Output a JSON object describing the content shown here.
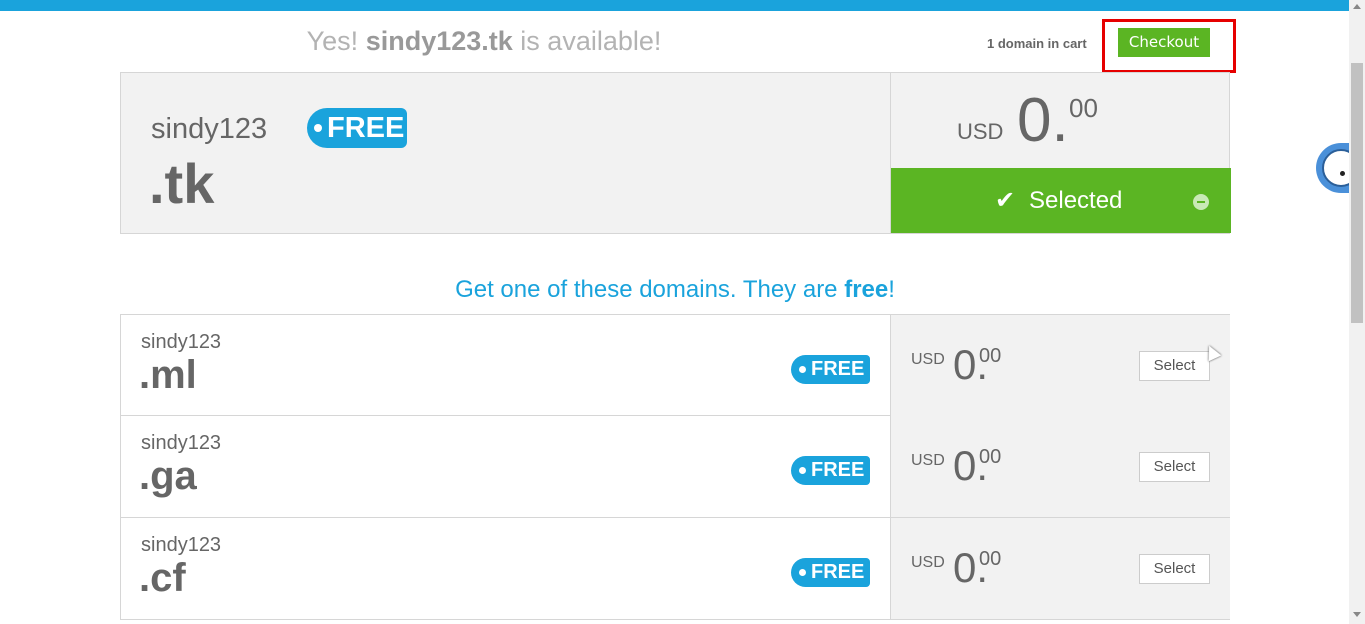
{
  "header": {
    "availability_prefix": "Yes!",
    "availability_domain": "sindy123.tk",
    "availability_suffix": "is available!",
    "cart_count_text": "1 domain in cart",
    "checkout_label": "Checkout"
  },
  "selected_domain": {
    "name": "sindy123",
    "tld": ".tk",
    "badge": "FREE",
    "currency": "USD",
    "price_int": "0.",
    "price_dec": "00",
    "selected_label": "Selected"
  },
  "suggestions": {
    "heading_prefix": "Get one of these domains. They are",
    "heading_bold": "free",
    "heading_suffix": "!",
    "items": [
      {
        "name": "sindy123",
        "tld": ".ml",
        "badge": "FREE",
        "currency": "USD",
        "price_int": "0.",
        "price_dec": "00",
        "select_label": "Select"
      },
      {
        "name": "sindy123",
        "tld": ".ga",
        "badge": "FREE",
        "currency": "USD",
        "price_int": "0.",
        "price_dec": "00",
        "select_label": "Select"
      },
      {
        "name": "sindy123",
        "tld": ".cf",
        "badge": "FREE",
        "currency": "USD",
        "price_int": "0.",
        "price_dec": "00",
        "select_label": "Select"
      }
    ]
  },
  "colors": {
    "accent_blue": "#1aa3dc",
    "accent_green": "#5bb523",
    "highlight_red": "#e60000"
  }
}
